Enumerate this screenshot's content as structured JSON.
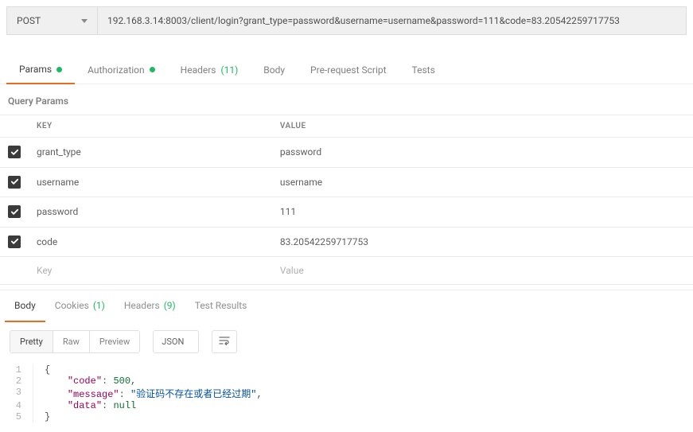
{
  "request": {
    "method": "POST",
    "url": "192.168.3.14:8003/client/login?grant_type=password&username=username&password=111&code=83.20542259717753"
  },
  "tabs": {
    "params": "Params",
    "authorization": "Authorization",
    "headers": "Headers",
    "headers_count": "(11)",
    "body": "Body",
    "prerequest": "Pre-request Script",
    "tests": "Tests"
  },
  "query_params": {
    "title": "Query Params",
    "key_header": "KEY",
    "value_header": "VALUE",
    "rows": [
      {
        "key": "grant_type",
        "value": "password"
      },
      {
        "key": "username",
        "value": "username"
      },
      {
        "key": "password",
        "value": "111"
      },
      {
        "key": "code",
        "value": "83.20542259717753"
      }
    ],
    "key_placeholder": "Key",
    "value_placeholder": "Value"
  },
  "response_tabs": {
    "body": "Body",
    "cookies": "Cookies",
    "cookies_count": "(1)",
    "headers": "Headers",
    "headers_count": "(9)",
    "test_results": "Test Results"
  },
  "viewer": {
    "pretty": "Pretty",
    "raw": "Raw",
    "preview": "Preview",
    "format": "JSON"
  },
  "response_body": {
    "code_label": "\"code\"",
    "code_value": "500",
    "message_label": "\"message\"",
    "message_value": "\"验证码不存在或者已经过期\"",
    "data_label": "\"data\"",
    "data_value": "null"
  }
}
